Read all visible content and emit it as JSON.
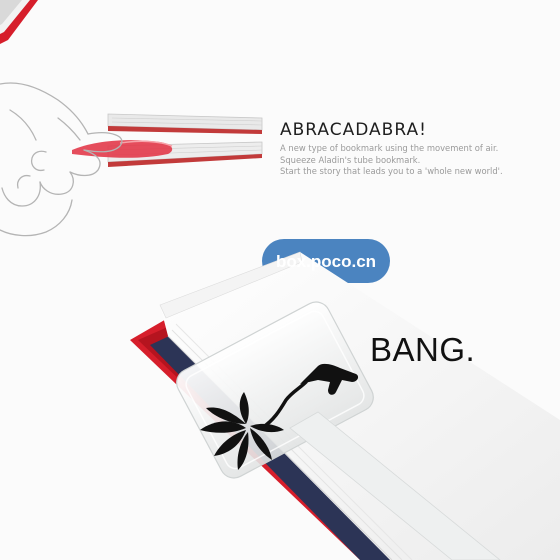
{
  "headline": "ABRACADABRA!",
  "description": [
    "A new type of bookmark using the movement of air.",
    "Squeeze Aladin's tube bookmark.",
    "Start the story that leads you to a 'whole new world'."
  ],
  "watermark": "box.poco.cn",
  "tagline": "BANG.",
  "colors": {
    "book_cover": "#d61e2b",
    "bubble": "#4b84c0",
    "bookmark_tip": "#e23a4a",
    "text_dark": "#1e1e1e",
    "text_grey": "#9a9a9a"
  }
}
